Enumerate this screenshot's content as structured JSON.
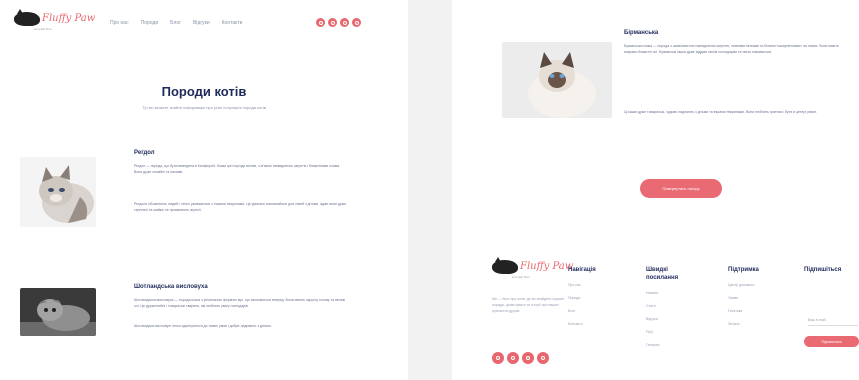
{
  "colors": {
    "accent": "#ea6a73",
    "navy": "#1f2a5a",
    "muted": "#8b93a8"
  },
  "logo": {
    "script": "Fluffy Paw",
    "tag": "котячий блог"
  },
  "nav": [
    "Про нас",
    "Породи",
    "Блог",
    "Відгуки",
    "Контакти"
  ],
  "socials": [
    "facebook-icon",
    "instagram-icon",
    "twitter-icon",
    "youtube-icon"
  ],
  "page_title": "Породи котів",
  "lead": "Тут ви можете знайти інформацію про різні популярні породи котів",
  "breeds": [
    {
      "title": "Регдол",
      "p1": "Регдол — порода, що була виведена в Каліфорнії. Кішки цієї породи великі, з м'якою напівдовгою шерстю і блакитними очима. Вони дуже спокійні та ласкаві.",
      "p2": "Регдоли обожнюють людей і легко уживаються з іншими тваринами. Це ідеальні компаньйони для сімей з дітьми, адже вони дуже терплячі та майже не проявляють агресії."
    },
    {
      "title": "Шотландська висловуха",
      "p1": "Шотландська висловуха — порода кішок з унікальною формою вух, що загинаються вперед. Вони мають округлу голову та великі очі. Це дружелюбні і товариські тварини, які люблять увагу господарів.",
      "p2": "Шотландські висловухі легко адаптуються до нових умов і добре ладнають з дітьми."
    },
    {
      "title": "Бірманська",
      "p1": "Бірманська кішка — порода з шовковистою напівдовгою шерстю, темними мітками та білими «шкарпетками» на лапах. Вони мають яскраво-блакитні очі. Бірманські кішки дуже віддані своїм господарям та легко навчаються.",
      "p2": "Ці кішки дуже товариські, чудово ладнають з дітьми та іншими тваринами. Вони люблять гратися і бути в центрі уваги."
    }
  ],
  "cta": "Повернутись нагору",
  "footer": {
    "desc": "Ми — блог про котів, де ви знайдете корисні поради, цікаві факти та історії про наших пухнастих друзів.",
    "cols": [
      {
        "title": "Навігація",
        "links": [
          "Про нас",
          "Породи",
          "Блог",
          "Контакти"
        ]
      },
      {
        "title": "Швидкі посилання",
        "links": [
          "Новини",
          "Статті",
          "Відгуки",
          "FAQ",
          "Галерея"
        ]
      },
      {
        "title": "Підтримка",
        "links": [
          "Центр допомоги",
          "Умови",
          "Політика",
          "Зв'язок"
        ]
      },
      {
        "title": "Підпишіться",
        "links": []
      }
    ],
    "email_placeholder": "Ваш e-mail",
    "subscribe": "Підписатися"
  }
}
